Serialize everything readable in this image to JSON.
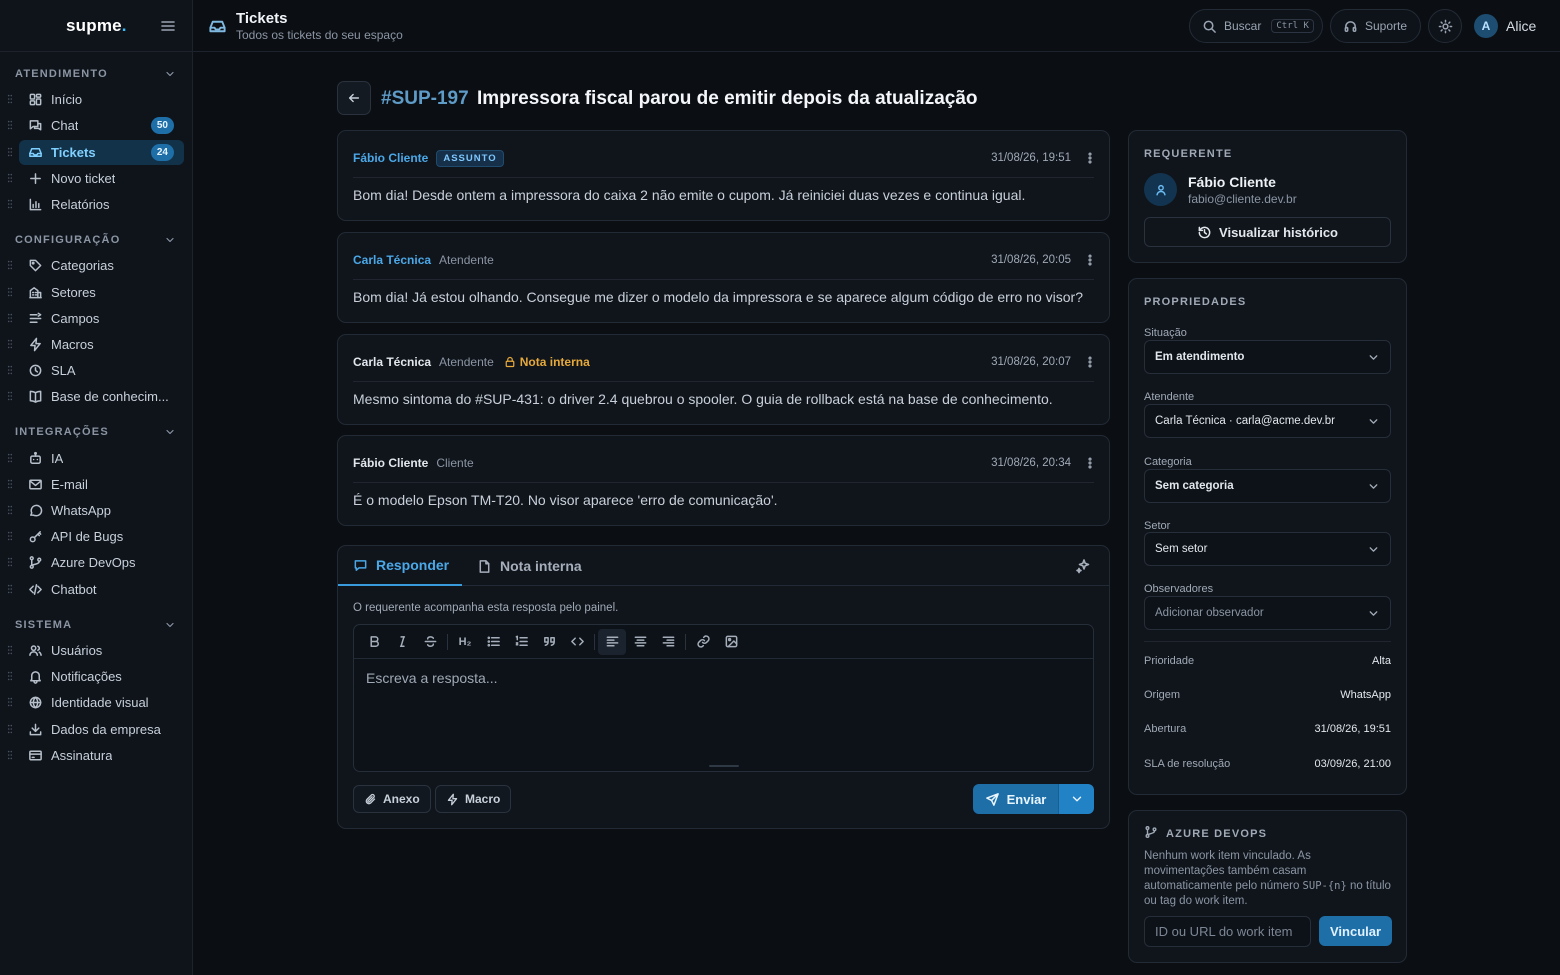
{
  "sidebar": {
    "logo": "supme",
    "logo_dot": ".",
    "sections": [
      {
        "title": "ATENDIMENTO",
        "items": [
          {
            "label": "Início",
            "icon": "dashboard-icon"
          },
          {
            "label": "Chat",
            "icon": "chat-icon",
            "badge": "50"
          },
          {
            "label": "Tickets",
            "icon": "inbox-icon",
            "badge": "24",
            "active": true
          },
          {
            "label": "Novo ticket",
            "icon": "plus-icon"
          },
          {
            "label": "Relatórios",
            "icon": "bar-chart-icon"
          }
        ]
      },
      {
        "title": "CONFIGURAÇÃO",
        "items": [
          {
            "label": "Categorias",
            "icon": "tag-icon"
          },
          {
            "label": "Setores",
            "icon": "building-icon"
          },
          {
            "label": "Campos",
            "icon": "fields-icon"
          },
          {
            "label": "Macros",
            "icon": "zap-icon"
          },
          {
            "label": "SLA",
            "icon": "clock-icon"
          },
          {
            "label": "Base de conhecim...",
            "icon": "book-icon"
          }
        ]
      },
      {
        "title": "INTEGRAÇÕES",
        "items": [
          {
            "label": "IA",
            "icon": "bot-icon"
          },
          {
            "label": "E-mail",
            "icon": "mail-icon"
          },
          {
            "label": "WhatsApp",
            "icon": "message-circle-icon"
          },
          {
            "label": "API de Bugs",
            "icon": "key-icon"
          },
          {
            "label": "Azure DevOps",
            "icon": "git-branch-icon"
          },
          {
            "label": "Chatbot",
            "icon": "code-icon"
          }
        ]
      },
      {
        "title": "SISTEMA",
        "items": [
          {
            "label": "Usuários",
            "icon": "users-icon"
          },
          {
            "label": "Notificações",
            "icon": "bell-icon"
          },
          {
            "label": "Identidade visual",
            "icon": "globe-icon"
          },
          {
            "label": "Dados da empresa",
            "icon": "download-icon"
          },
          {
            "label": "Assinatura",
            "icon": "credit-card-icon"
          }
        ]
      }
    ]
  },
  "topbar": {
    "title": "Tickets",
    "subtitle": "Todos os tickets do seu espaço",
    "search_label": "Buscar",
    "search_kbd": "Ctrl K",
    "support_label": "Suporte",
    "user_initial": "A",
    "user_name": "Alice"
  },
  "ticket": {
    "id": "#SUP-197",
    "title": "Impressora fiscal parou de emitir depois da atualização"
  },
  "messages": [
    {
      "author": "Fábio Cliente",
      "author_color": "#4aa8e8",
      "tag": "ASSUNTO",
      "role": "",
      "internal": "",
      "time": "31/08/26, 19:51",
      "body": "Bom dia! Desde ontem a impressora do caixa 2 não emite o cupom. Já reiniciei duas vezes e continua igual."
    },
    {
      "author": "Carla Técnica",
      "author_color": "#4aa8e8",
      "tag": "",
      "role": "Atendente",
      "internal": "",
      "time": "31/08/26, 20:05",
      "body": "Bom dia! Já estou olhando. Consegue me dizer o modelo da impressora e se aparece algum código de erro no visor?"
    },
    {
      "author": "Carla Técnica",
      "author_color": "#e2e7ee",
      "tag": "",
      "role": "Atendente",
      "internal": "Nota interna",
      "time": "31/08/26, 20:07",
      "body": "Mesmo sintoma do #SUP-431: o driver 2.4 quebrou o spooler. O guia de rollback está na base de conhecimento."
    },
    {
      "author": "Fábio Cliente",
      "author_color": "#e2e7ee",
      "tag": "",
      "role": "Cliente",
      "internal": "",
      "time": "31/08/26, 20:34",
      "body": "É o modelo Epson TM-T20. No visor aparece 'erro de comunicação'."
    }
  ],
  "reply": {
    "tab_reply": "Responder",
    "tab_note": "Nota interna",
    "hint": "O requerente acompanha esta resposta pelo painel.",
    "heading_btn": "H₂",
    "placeholder": "Escreva a resposta...",
    "attach_label": "Anexo",
    "macro_label": "Macro",
    "send_label": "Enviar"
  },
  "requester": {
    "title": "REQUERENTE",
    "name": "Fábio Cliente",
    "email": "fabio@cliente.dev.br",
    "history_label": "Visualizar histórico"
  },
  "properties": {
    "title": "PROPRIEDADES",
    "fields": [
      {
        "label": "Situação",
        "value": "Em atendimento",
        "bold": true
      },
      {
        "label": "Atendente",
        "value": "Carla Técnica · carla@acme.dev.br",
        "bold": false
      },
      {
        "label": "Categoria",
        "value": "Sem categoria",
        "bold": true
      },
      {
        "label": "Setor",
        "value": "Sem setor",
        "bold": false
      },
      {
        "label": "Observadores",
        "value": "Adicionar observador",
        "placeholder": true
      }
    ],
    "rows": [
      {
        "key": "Prioridade",
        "value": "Alta"
      },
      {
        "key": "Origem",
        "value": "WhatsApp"
      },
      {
        "key": "Abertura",
        "value": "31/08/26, 19:51"
      },
      {
        "key": "SLA de resolução",
        "value": "03/09/26, 21:00"
      }
    ]
  },
  "azure": {
    "title": "AZURE DEVOPS",
    "text_before": "Nenhum work item vinculado. As movimentações também casam automaticamente pelo número ",
    "text_code": "SUP-{n}",
    "text_after": " no título ou tag do work item.",
    "input_placeholder": "ID ou URL do work item",
    "link_label": "Vincular"
  },
  "colors": {
    "accent": "#1e6fa8",
    "link": "#4aa8e8",
    "internal_note": "#e6a93a",
    "background": "#0b0f14"
  }
}
